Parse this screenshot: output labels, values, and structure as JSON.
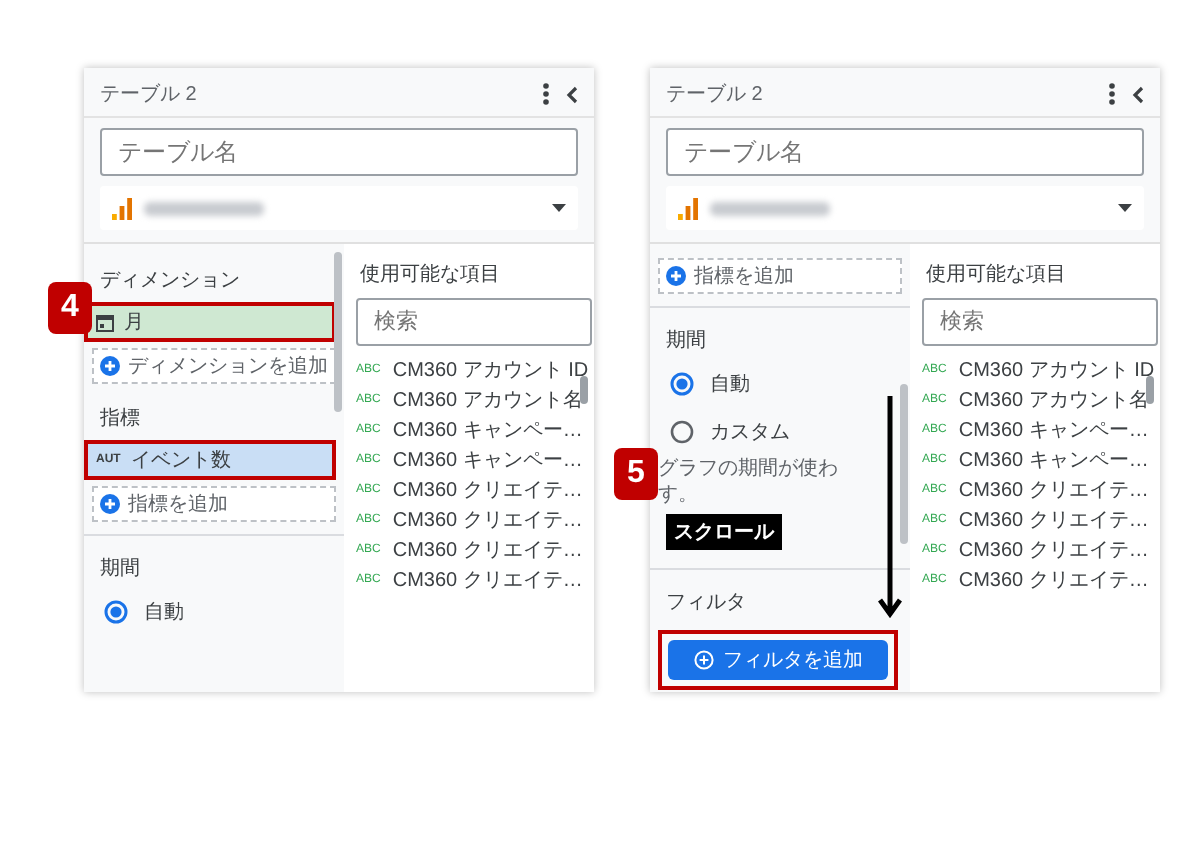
{
  "panels": [
    {
      "step": "4",
      "title": "テーブル 2",
      "name_placeholder": "テーブル名",
      "available_heading": "使用可能な項目",
      "search_placeholder": "検索",
      "sections": [
        {
          "kind": "heading",
          "text": "ディメンション"
        },
        {
          "kind": "date-chip",
          "label": "月",
          "highlighted": true
        },
        {
          "kind": "add",
          "label": "ディメンションを追加"
        },
        {
          "kind": "heading",
          "text": "指標"
        },
        {
          "kind": "metric-chip",
          "tag": "AUT",
          "label": "イベント数",
          "highlighted": true
        },
        {
          "kind": "add",
          "label": "指標を追加"
        },
        {
          "kind": "divider"
        },
        {
          "kind": "heading",
          "text": "期間"
        },
        {
          "kind": "radio",
          "label": "自動",
          "selected": true
        }
      ],
      "fields": [
        {
          "tag": "ABC",
          "label": "CM360 アカウント ID"
        },
        {
          "tag": "ABC",
          "label": "CM360 アカウント名"
        },
        {
          "tag": "ABC",
          "label": "CM360 キャンペー…"
        },
        {
          "tag": "ABC",
          "label": "CM360 キャンペー…"
        },
        {
          "tag": "ABC",
          "label": "CM360 クリエイテ…"
        },
        {
          "tag": "ABC",
          "label": "CM360 クリエイテ…"
        },
        {
          "tag": "ABC",
          "label": "CM360 クリエイテ…"
        },
        {
          "tag": "ABC",
          "label": "CM360 クリエイテ…"
        }
      ]
    },
    {
      "step": "5",
      "title": "テーブル 2",
      "name_placeholder": "テーブル名",
      "available_heading": "使用可能な項目",
      "search_placeholder": "検索",
      "scroll_label": "スクロール",
      "sections": [
        {
          "kind": "add",
          "label": "指標を追加"
        },
        {
          "kind": "divider"
        },
        {
          "kind": "heading",
          "text": "期間"
        },
        {
          "kind": "radio",
          "label": "自動",
          "selected": true
        },
        {
          "kind": "radio",
          "label": "カスタム",
          "selected": false
        },
        {
          "kind": "note",
          "text": "グラフの期間が使わ"
        },
        {
          "kind": "note",
          "text": "す。"
        },
        {
          "kind": "divider"
        },
        {
          "kind": "heading",
          "text": "フィルタ"
        },
        {
          "kind": "button",
          "label": "フィルタを追加",
          "highlighted": true
        }
      ],
      "fields": [
        {
          "tag": "ABC",
          "label": "CM360 アカウント ID"
        },
        {
          "tag": "ABC",
          "label": "CM360 アカウント名"
        },
        {
          "tag": "ABC",
          "label": "CM360 キャンペー…"
        },
        {
          "tag": "ABC",
          "label": "CM360 キャンペー…"
        },
        {
          "tag": "ABC",
          "label": "CM360 クリエイテ…"
        },
        {
          "tag": "ABC",
          "label": "CM360 クリエイテ…"
        },
        {
          "tag": "ABC",
          "label": "CM360 クリエイテ…"
        },
        {
          "tag": "ABC",
          "label": "CM360 クリエイテ…"
        }
      ]
    }
  ]
}
